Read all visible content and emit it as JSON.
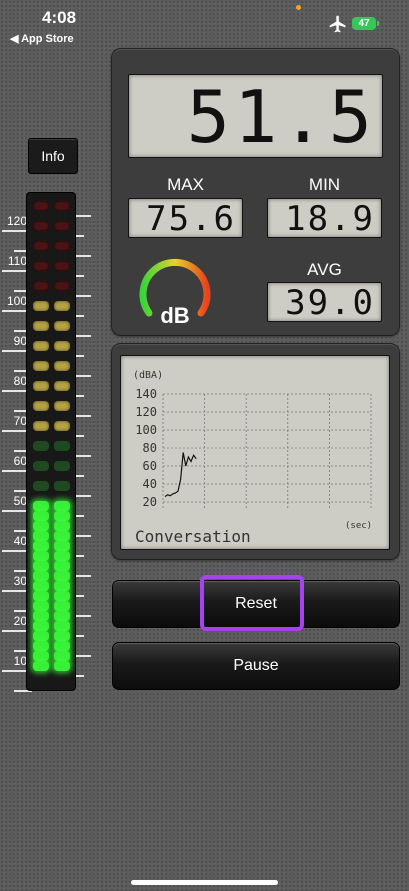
{
  "status_bar": {
    "time": "4:08",
    "back_label": "◀ App Store",
    "battery": "47"
  },
  "info_button": {
    "label": "Info"
  },
  "meter": {
    "scale_labels": [
      "120",
      "110",
      "100",
      "90",
      "80",
      "70",
      "60",
      "50",
      "40",
      "30",
      "20",
      "10"
    ],
    "current_level_db": 51.5
  },
  "readings": {
    "current": "51.5",
    "max_label": "MAX",
    "max": "75.6",
    "min_label": "MIN",
    "min": "18.9",
    "avg_label": "AVG",
    "avg": "39.0",
    "gauge_label": "dB"
  },
  "graph": {
    "unit_top": "(dBA)",
    "y_ticks": [
      "140",
      "120",
      "100",
      "80",
      "60",
      "40",
      "20"
    ],
    "unit_bottom": "(sec)",
    "caption": "Conversation"
  },
  "chart_data": {
    "type": "line",
    "ylabel": "(dBA)",
    "xlabel": "(sec)",
    "ylim": [
      10,
      150
    ],
    "series": [
      {
        "values": [
          26,
          28,
          27,
          29,
          30,
          32,
          45,
          75,
          60,
          70,
          65,
          72,
          68
        ]
      }
    ]
  },
  "buttons": {
    "reset": "Reset",
    "pause": "Pause"
  },
  "colors": {
    "highlight": "#a642ee",
    "led_green": "#38f038",
    "led_yellow": "#b4a244",
    "led_red": "#4a1414"
  }
}
